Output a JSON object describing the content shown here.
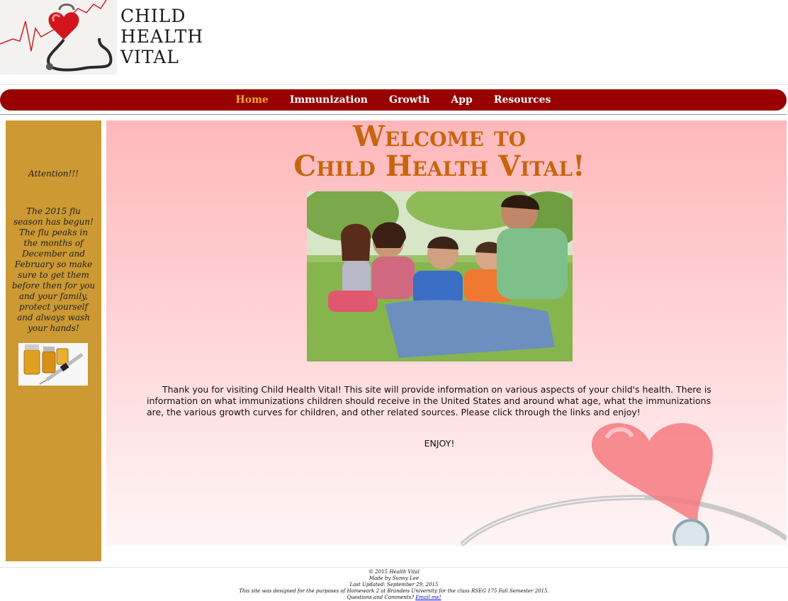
{
  "logo": {
    "line1": "CHILD",
    "line2": "HEALTH",
    "line3": "VITAL"
  },
  "nav": {
    "items": [
      {
        "label": "Home",
        "active": true
      },
      {
        "label": "Immunization",
        "active": false
      },
      {
        "label": "Growth",
        "active": false
      },
      {
        "label": "App",
        "active": false
      },
      {
        "label": "Resources",
        "active": false
      }
    ]
  },
  "sidebar": {
    "attention": "Attention!!!",
    "flu_text": "The 2015 flu season has begun! The flu peaks in the months of December and February so make sure to get them before then for you and your family, protect yourself and always wash your hands!"
  },
  "main": {
    "welcome_line1": "Welcome to",
    "welcome_line2": "Child Health Vital!",
    "intro": "Thank you for visiting Child Health Vital! This site will provide information on various aspects of your child's health. There is information on what immunizations children should receive in the United States and around what age, what the immunizations are, the various growth curves for children, and other related sources. Please click through the links and enjoy!",
    "enjoy": "ENJOY!"
  },
  "footer": {
    "copyright": "© 2015 Health Vital",
    "made_by": "Made by Sunny Lee",
    "updated": "Last Updated: September 29, 2015",
    "purpose": "This site was designed for the purposes of Homework 2 at Brandeis University for the class RSEG 175 Fall Semester 2015.",
    "questions": "Questions and Comments?",
    "email_link": "Email me!"
  },
  "colors": {
    "nav_bg": "#990000",
    "nav_active": "#f0a830",
    "sidebar_bg": "#cc9933",
    "welcome_text": "#c8640c"
  }
}
